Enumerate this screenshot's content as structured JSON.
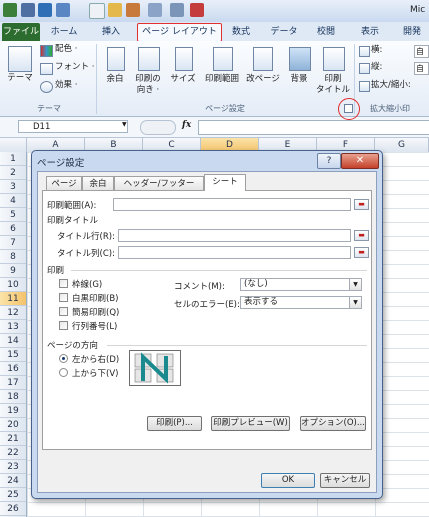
{
  "quick_access": {
    "title_text": "Mic"
  },
  "tabs": [
    "ファイル",
    "ホーム",
    "挿入",
    "ページ レイアウト",
    "数式",
    "データ",
    "校閲",
    "表示",
    "開発"
  ],
  "ribbon": {
    "theme_group": {
      "theme_button": "テーマ",
      "colors": "配色 ·",
      "fonts": "フォント ·",
      "effects": "効果 ·",
      "label": "テーマ"
    },
    "page_setup_group": {
      "margins": "余白",
      "orientation_1": "印刷の",
      "orientation_2": "向き ·",
      "size": "サイズ",
      "print_area": "印刷範囲",
      "breaks": "改ページ",
      "background": "背景",
      "print_titles_1": "印刷",
      "print_titles_2": "タイトル",
      "label": "ページ設定"
    },
    "scale_group": {
      "width": "横:",
      "height": "縦:",
      "scale": "拡大/縮小:",
      "width_val": "自動",
      "height_val": "自動",
      "label": "拡大縮小印"
    }
  },
  "formula_bar": {
    "name_box": "D11",
    "fx": "fx",
    "content": ""
  },
  "columns": [
    "A",
    "B",
    "C",
    "D",
    "E",
    "F",
    "G"
  ],
  "rows": [
    "1",
    "2",
    "3",
    "4",
    "5",
    "6",
    "7",
    "8",
    "9",
    "10",
    "11",
    "12",
    "13",
    "14",
    "15",
    "16",
    "17",
    "18",
    "19",
    "20",
    "21",
    "22",
    "23",
    "24",
    "25",
    "26"
  ],
  "dialog": {
    "title": "ページ設定",
    "help": "?",
    "close": "✕",
    "tabs": [
      "ページ",
      "余白",
      "ヘッダー/フッター",
      "シート"
    ],
    "print_area_label": "印刷範囲(A):",
    "print_titles_label": "印刷タイトル",
    "title_rows_label": "タイトル行(R):",
    "title_cols_label": "タイトル列(C):",
    "print_section_label": "印刷",
    "checkboxes": [
      "枠線(G)",
      "白黒印刷(B)",
      "簡易印刷(Q)",
      "行列番号(L)"
    ],
    "comments_label": "コメント(M):",
    "comments_value": "(なし)",
    "cell_errors_label": "セルのエラー(E):",
    "cell_errors_value": "表示する",
    "page_order_label": "ページの方向",
    "radio_ltr": "左から右(D)",
    "radio_ttb": "上から下(V)",
    "print_button": "印刷(P)...",
    "preview_button": "印刷プレビュー(W)",
    "options_button": "オプション(O)...",
    "ok_button": "OK",
    "cancel_button": "キャンセル"
  },
  "colors": {
    "file_tab": "#2c6c2e",
    "highlight": "#e02a2a",
    "selected_row_header": "#f5c36b"
  }
}
